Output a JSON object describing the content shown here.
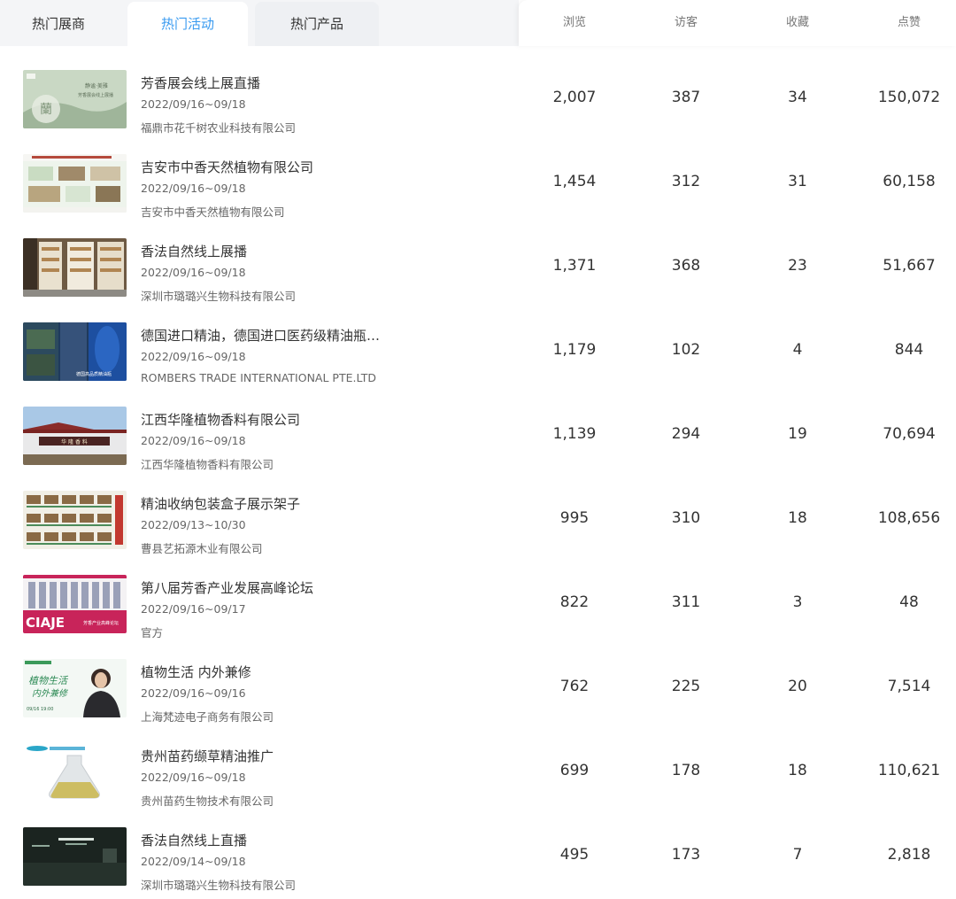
{
  "tabs": [
    {
      "label": "热门展商"
    },
    {
      "label": "热门活动"
    },
    {
      "label": "热门产品"
    },
    {
      "label": ""
    }
  ],
  "columns": [
    "浏览",
    "访客",
    "收藏",
    "点赞"
  ],
  "rows": [
    {
      "title": "芳香展会线上展直播",
      "date": "2022/09/16~09/18",
      "org": "福鼎市花千树农业科技有限公司",
      "views": "2,007",
      "visitors": "387",
      "favorites": "34",
      "likes": "150,072",
      "thumb": "banner-green-calligraphy"
    },
    {
      "title": "吉安市中香天然植物有限公司",
      "date": "2022/09/16~09/18",
      "org": "吉安市中香天然植物有限公司",
      "views": "1,454",
      "visitors": "312",
      "favorites": "31",
      "likes": "60,158",
      "thumb": "product-catalog"
    },
    {
      "title": "香法自然线上展播",
      "date": "2022/09/16~09/18",
      "org": "深圳市璐璐兴生物科技有限公司",
      "views": "1,371",
      "visitors": "368",
      "favorites": "23",
      "likes": "51,667",
      "thumb": "display-shelves"
    },
    {
      "title": "德国进口精油，德国进口医药级精油瓶…",
      "date": "2022/09/16~09/18",
      "org": "ROMBERS TRADE INTERNATIONAL PTE.LTD",
      "views": "1,179",
      "visitors": "102",
      "favorites": "4",
      "likes": "844",
      "thumb": "factory-blue"
    },
    {
      "title": "江西华隆植物香料有限公司",
      "date": "2022/09/16~09/18",
      "org": "江西华隆植物香料有限公司",
      "views": "1,139",
      "visitors": "294",
      "favorites": "19",
      "likes": "70,694",
      "thumb": "factory-building"
    },
    {
      "title": "精油收纳包装盒子展示架子",
      "date": "2022/09/13~10/30",
      "org": "曹县艺拓源木业有限公司",
      "views": "995",
      "visitors": "310",
      "favorites": "18",
      "likes": "108,656",
      "thumb": "box-grid"
    },
    {
      "title": "第八届芳香产业发展高峰论坛",
      "date": "2022/09/16~09/17",
      "org": "官方",
      "views": "822",
      "visitors": "311",
      "favorites": "3",
      "likes": "48",
      "thumb": "forum-pink"
    },
    {
      "title": "植物生活 内外兼修",
      "date": "2022/09/16~09/16",
      "org": "上海梵迹电子商务有限公司",
      "views": "762",
      "visitors": "225",
      "favorites": "20",
      "likes": "7,514",
      "thumb": "live-poster"
    },
    {
      "title": "贵州苗药缬草精油推广",
      "date": "2022/09/16~09/18",
      "org": "贵州苗药生物技术有限公司",
      "views": "699",
      "visitors": "178",
      "favorites": "18",
      "likes": "110,621",
      "thumb": "flask-oil"
    },
    {
      "title": "香法自然线上直播",
      "date": "2022/09/14~09/18",
      "org": "深圳市璐璐兴生物科技有限公司",
      "views": "495",
      "visitors": "173",
      "favorites": "7",
      "likes": "2,818",
      "thumb": "dark-stage"
    }
  ],
  "thumb_texts": {
    "t0_line1": "静谧·美雅",
    "t0_line2": "芳香展会线上展播",
    "t3_caption": "德国高品质精油瓶",
    "t4_sign": "华 隆 香 料",
    "t6_brand": "CIAJE",
    "t6_caption": "芳香产业高峰论坛",
    "t7_line1": "植物生活",
    "t7_line2": "内外兼修",
    "t7_time": "09/16 19:00"
  },
  "colors": {
    "accent": "#3a9bf0",
    "tab_bg": "#f4f5f7",
    "text": "#333333",
    "muted": "#666666"
  }
}
